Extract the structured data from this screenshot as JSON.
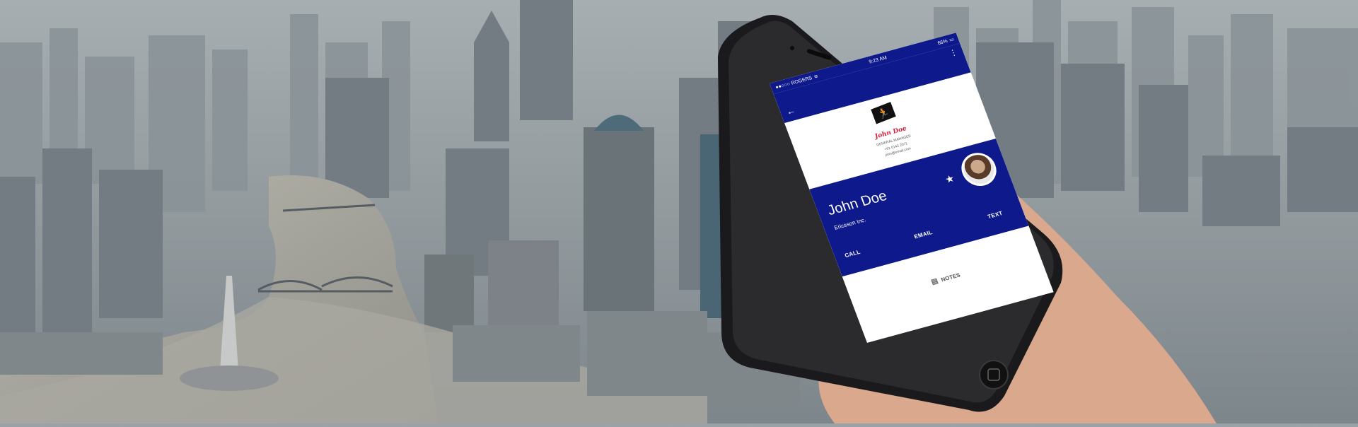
{
  "status_bar": {
    "carrier": "●●○○○ ROGERS",
    "wifi_icon": "wifi-icon",
    "time": "9:23 AM",
    "battery": "66%",
    "battery_icon": "battery-icon"
  },
  "app_bar": {
    "back_icon": "arrow-left-icon",
    "menu_icon": "more-vertical-icon"
  },
  "business_card": {
    "logo_icon": "running-figure-icon",
    "name": "John Doe",
    "title": "GENERAL MANAGER",
    "phone": "+61 0142 2071",
    "email": "john@email.com"
  },
  "contact": {
    "name": "John Doe",
    "company": "Ericsson Inc.",
    "favorite_icon": "star-icon",
    "actions": {
      "call": "CALL",
      "email": "EMAIL",
      "text": "TEXT"
    }
  },
  "notes": {
    "label": "NOTES",
    "icon": "notes-icon"
  },
  "colors": {
    "primary": "#0e1a8c",
    "card_name": "#d0213a"
  }
}
